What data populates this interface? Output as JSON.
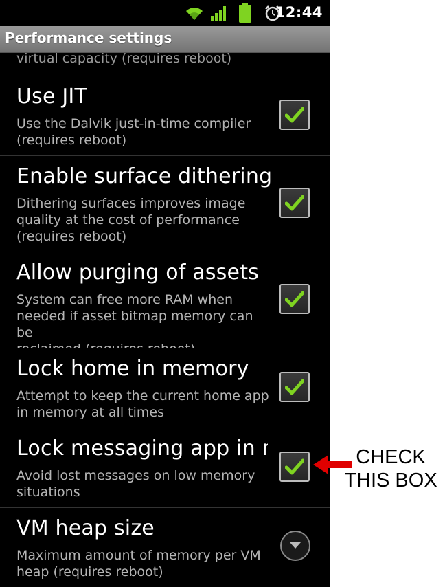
{
  "status_bar": {
    "time": "12:44",
    "icons": [
      "wifi-icon",
      "signal-icon",
      "battery-icon",
      "alarm-icon"
    ]
  },
  "title_bar": {
    "title": "Performance settings"
  },
  "list": {
    "partial_summary": "virtual capacity (requires reboot)",
    "items": [
      {
        "title": "Use JIT",
        "summary": "Use the Dalvik just-in-time compiler\n(requires reboot)",
        "checked": true,
        "widget": "checkbox"
      },
      {
        "title": "Enable surface dithering",
        "summary": "Dithering surfaces improves image\nquality at the cost of performance\n(requires reboot)",
        "checked": true,
        "widget": "checkbox"
      },
      {
        "title": "Allow purging of assets",
        "summary": "System can free more RAM when\nneeded if asset bitmap memory can be\nreclaimed (requires reboot)",
        "checked": true,
        "widget": "checkbox"
      },
      {
        "title": "Lock home in memory",
        "summary": "Attempt to keep the current home app\nin memory at all times",
        "checked": true,
        "widget": "checkbox"
      },
      {
        "title": "Lock messaging app in m",
        "summary": "Avoid lost messages on low memory\nsituations",
        "checked": true,
        "widget": "checkbox"
      },
      {
        "title": "VM heap size",
        "summary": "Maximum amount of memory per VM\nheap (requires reboot)",
        "widget": "dropdown"
      }
    ]
  },
  "annotation": {
    "line1": "CHECK",
    "line2": "THIS BOX",
    "color": "#e00000"
  },
  "colors": {
    "checkmark": "#7fd321",
    "background": "#000000",
    "title_bar": "#8a8a8a"
  }
}
